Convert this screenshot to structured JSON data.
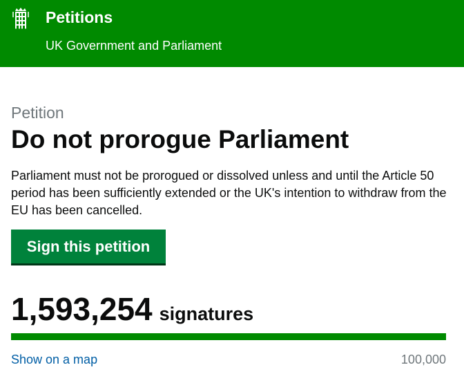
{
  "header": {
    "title": "Petitions",
    "subtitle": "UK Government and Parliament",
    "logo_icon": "portcullis-icon",
    "background_color": "#008a00"
  },
  "petition": {
    "caption": "Petition",
    "title": "Do not prorogue Parliament",
    "description": "Parliament must not be prorogued or dissolved unless and until the Article 50 period has been sufficiently extended or the UK's intention to withdraw from the EU has been cancelled."
  },
  "actions": {
    "sign_label": "Sign this petition",
    "sign_color": "#00823b"
  },
  "signatures": {
    "count": "1,593,254",
    "label": "signatures",
    "progress_fraction": 1.0,
    "progress_color": "#008a00",
    "map_link": "Show on a map",
    "threshold": "100,000"
  }
}
